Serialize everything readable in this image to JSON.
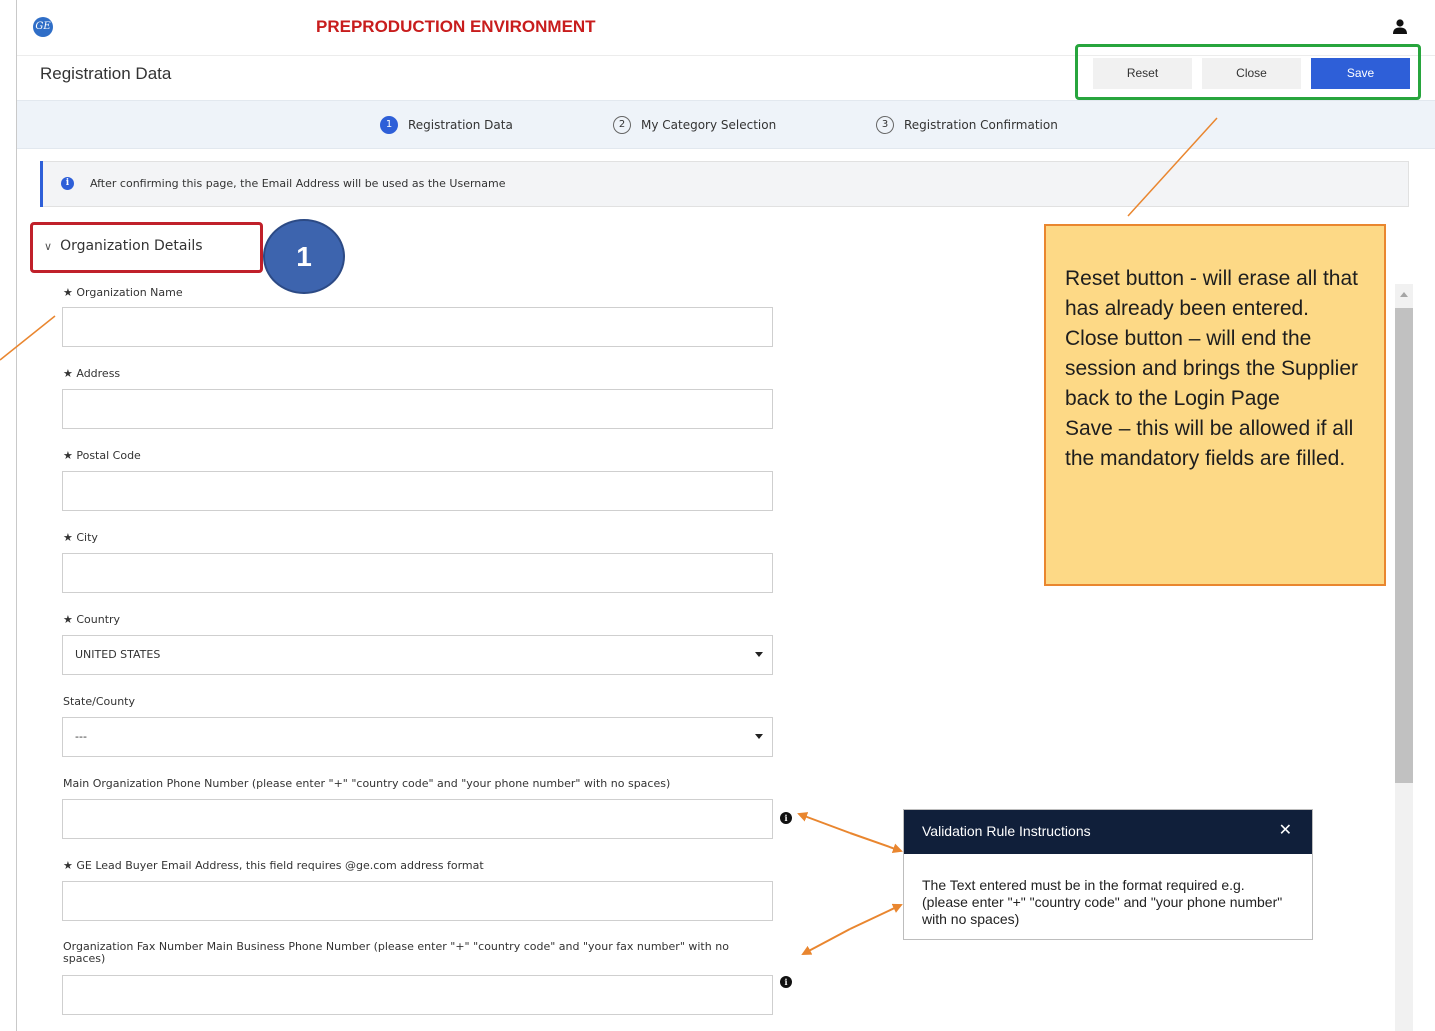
{
  "topbar": {
    "logo_text": "GE",
    "env_title": "PREPRODUCTION ENVIRONMENT"
  },
  "header": {
    "title": "Registration Data",
    "buttons": {
      "reset": "Reset",
      "close": "Close",
      "save": "Save"
    }
  },
  "steps": [
    {
      "num": "1",
      "label": "Registration Data",
      "active": true
    },
    {
      "num": "2",
      "label": "My Category Selection",
      "active": false
    },
    {
      "num": "3",
      "label": "Registration Confirmation",
      "active": false
    }
  ],
  "info_banner": {
    "icon": "i",
    "text": "After confirming this page, the Email Address will be used as the Username"
  },
  "section": {
    "title": "Organization Details",
    "badge": "1"
  },
  "fields": {
    "org_name": {
      "label": "★ Organization Name",
      "value": ""
    },
    "address": {
      "label": "★ Address",
      "value": ""
    },
    "postal_code": {
      "label": "★ Postal Code",
      "value": ""
    },
    "city": {
      "label": "★ City",
      "value": ""
    },
    "country": {
      "label": "★ Country",
      "value": "UNITED STATES"
    },
    "state": {
      "label": "State/County",
      "value": "---"
    },
    "phone": {
      "label": "Main Organization Phone Number (please enter \"+\" \"country code\" and \"your phone number\" with no spaces)",
      "value": ""
    },
    "buyer_email": {
      "label": "★ GE Lead Buyer Email Address, this field requires @ge.com address format",
      "value": ""
    },
    "fax": {
      "label": "Organization Fax Number Main Business Phone Number (please enter \"+\" \"country code\" and \"your fax number\" with no spaces)",
      "value": ""
    }
  },
  "help_icon_glyph": "i",
  "note": {
    "lines": [
      "Reset button - will erase all that has already been entered.",
      "Close button – will end the session and brings the Supplier back to the Login Page",
      "Save – this will be allowed if all the mandatory fields are filled."
    ]
  },
  "tooltip": {
    "title": "Validation Rule Instructions",
    "close": "✕",
    "body": "The Text entered must be in the format required e.g. (please enter \"+\" \"country code\" and \"your phone number\" with no spaces)"
  },
  "colors": {
    "brand_blue": "#2e5fd8",
    "env_red": "#c81d1d",
    "highlight_green": "#27a53d",
    "highlight_red": "#c0202a",
    "annotation_orange": "#e9862f",
    "note_fill": "#fdd986",
    "tooltip_header": "#101f3a"
  }
}
